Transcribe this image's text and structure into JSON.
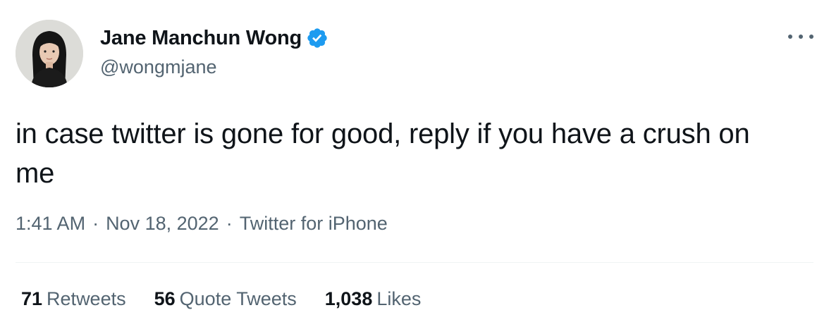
{
  "author": {
    "display_name": "Jane Manchun Wong",
    "handle": "@wongmjane",
    "verified": true,
    "verified_color": "#1d9bf0"
  },
  "tweet": {
    "text": "in case twitter is gone for good, reply if you have a crush on me",
    "time": "1:41 AM",
    "date": "Nov 18, 2022",
    "source": "Twitter for iPhone",
    "separator": "·"
  },
  "stats": [
    {
      "count": "71",
      "label": "Retweets"
    },
    {
      "count": "56",
      "label": "Quote Tweets"
    },
    {
      "count": "1,038",
      "label": "Likes"
    }
  ],
  "icons": {
    "more": "more-horizontal-icon",
    "verified": "verified-badge-icon"
  },
  "colors": {
    "text_primary": "#0f1419",
    "text_secondary": "#536471",
    "divider": "#eff3f4"
  }
}
